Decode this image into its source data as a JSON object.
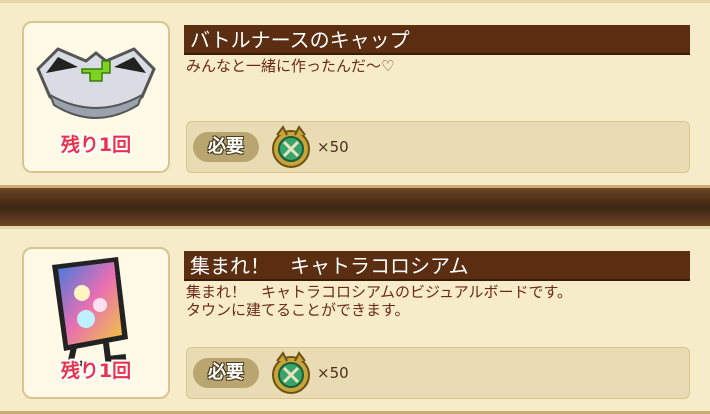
{
  "items": [
    {
      "title": "バトルナースのキャップ",
      "description": [
        "みんなと一緒に作ったんだ〜♡"
      ],
      "remaining": "残り1回",
      "requirement_label": "必要",
      "quantity": "×50",
      "icon": "nurse-cap-icon"
    },
    {
      "title": "集まれ！　キャトラコロシアム",
      "description": [
        "集まれ！　キャトラコロシアムのビジュアルボードです。",
        "タウンに建てることができます。"
      ],
      "remaining": "残り1回",
      "requirement_label": "必要",
      "quantity": "×50",
      "icon": "visual-board-icon"
    }
  ],
  "colors": {
    "title_bar": "#5b2e12",
    "remaining_text": "#e8334d",
    "card_bg": "#f6ecc9",
    "divider": "#4a2e17"
  }
}
